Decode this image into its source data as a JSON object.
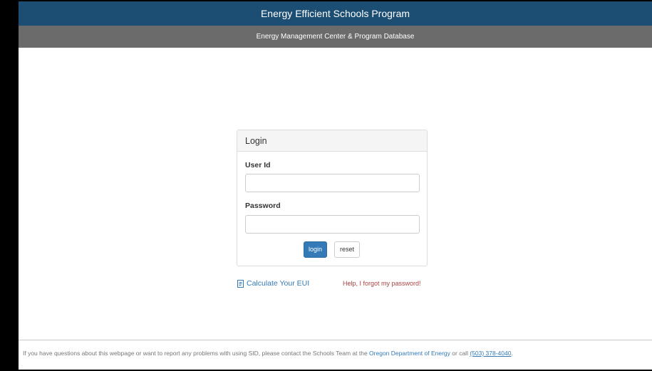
{
  "header": {
    "title": "Energy Efficient Schools Program",
    "subtitle": "Energy Management Center & Program Database"
  },
  "login": {
    "heading": "Login",
    "user_id_label": "User Id",
    "user_id_value": "",
    "password_label": "Password",
    "password_value": "",
    "login_button": "login",
    "reset_button": "reset"
  },
  "links": {
    "calculate_eui": "Calculate Your EUI",
    "forgot_password": "Help, I forgot my password!"
  },
  "footer": {
    "text_before": "If you have questions about this webpage or want to report any problems with using SID, please contact the Schools Team at the ",
    "org_link": "Oregon Department of Energy",
    "text_middle": " or call ",
    "phone_link": "(503) 378-4040",
    "text_after": "."
  },
  "colors": {
    "header_bg": "#1c4e74",
    "subheader_bg": "#6b6b6b",
    "primary_button": "#337ab7",
    "link": "#337ab7",
    "danger_link": "#a94442"
  },
  "icons": {
    "calculate_eui": "document-icon"
  }
}
